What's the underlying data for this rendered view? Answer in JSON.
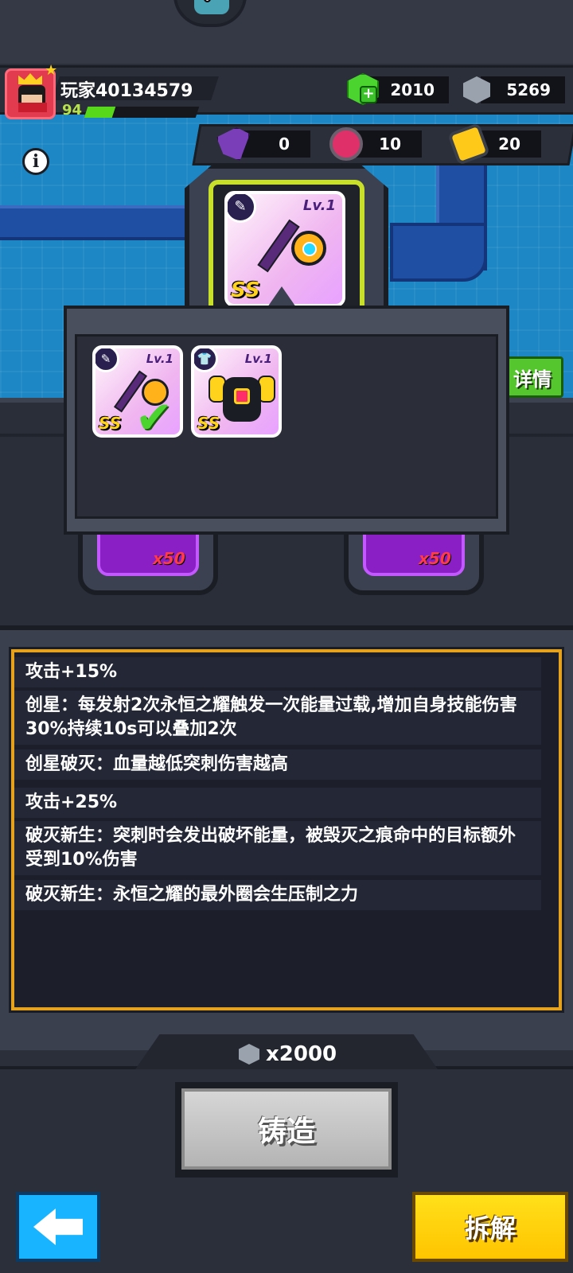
{
  "header": {
    "player_name": "玩家40134579",
    "level": "94",
    "exp_fraction": 0.25,
    "gems": "2010",
    "steel": "5269"
  },
  "materials": {
    "crystal": "0",
    "orb": "10",
    "battery": "20"
  },
  "equipped_item": {
    "level": "Lv.1",
    "rank": "SS"
  },
  "popup": {
    "items": [
      {
        "level": "Lv.1",
        "rank": "SS",
        "type": "weapon",
        "selected": true
      },
      {
        "level": "Lv.1",
        "rank": "SS",
        "type": "armor",
        "selected": false
      }
    ]
  },
  "detail_button": "详情",
  "material_slots": [
    {
      "count": "x50"
    },
    {
      "count": "x50"
    }
  ],
  "stats": [
    "攻击+15%",
    "创星：每发射2次永恒之耀触发一次能量过载,增加自身技能伤害30%持续10s可以叠加2次",
    "创星破灭：血量越低突刺伤害越高",
    "攻击+25%",
    "破灭新生：突刺时会发出破坏能量，被毁灭之痕命中的目标额外受到10%伤害",
    "破灭新生：永恒之耀的最外圈会生压制之力"
  ],
  "forge": {
    "cost": "x2000",
    "button_label": "铸造"
  },
  "dismantle_button": "拆解",
  "colors": {
    "accent_border": "#e6a21c",
    "detail_green": "#55c62e",
    "dismantle_yellow": "#ffd21c",
    "back_blue": "#19b4ff"
  }
}
